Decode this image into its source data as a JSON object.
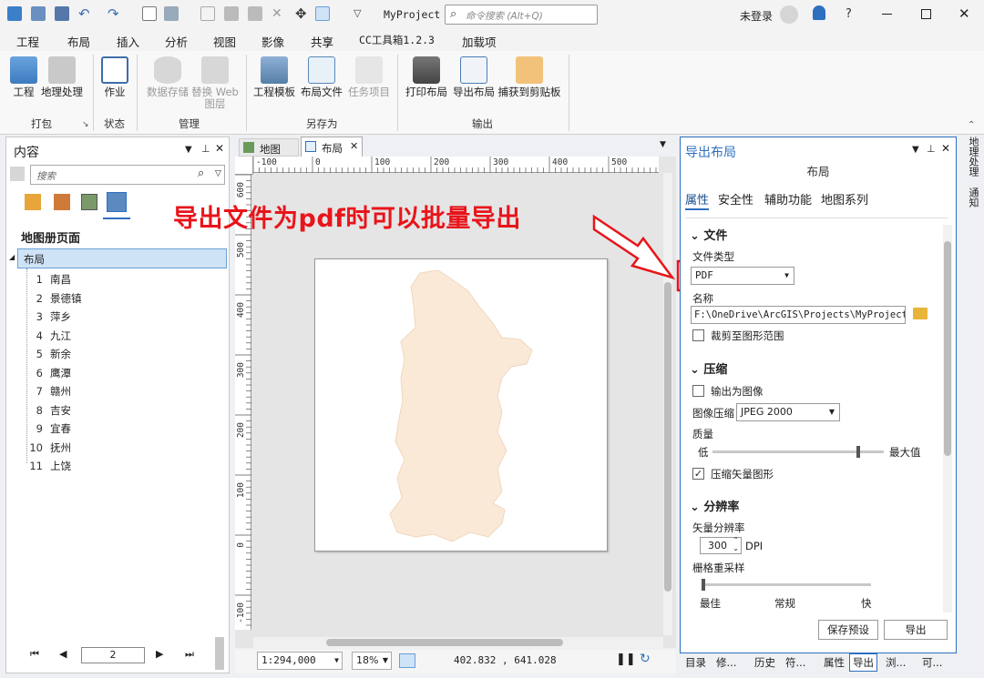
{
  "titlebar": {
    "project": "MyProject",
    "command_search_placeholder": "命令搜索 (Alt+Q)",
    "login_status": "未登录",
    "help_glyph": "?"
  },
  "ribbon_tabs": [
    "工程",
    "布局",
    "插入",
    "分析",
    "视图",
    "影像",
    "共享",
    "CC工具箱1.2.3",
    "加载项"
  ],
  "active_tab": "共享",
  "ribbon": {
    "project": "工程",
    "geoprocessing": "地理处理",
    "job": "作业",
    "data_store": "数据存储",
    "replace_web_layer_1": "替换",
    "replace_web_layer_2": "Web",
    "replace_web_layer_3": "图层",
    "project_template": "工程模板",
    "layout_file": "布局文件",
    "task_item": "任务项目",
    "print_layout": "打印布局",
    "export_layout": "导出布局",
    "capture_clipboard": "捕获到剪贴板",
    "group_package": "打包",
    "group_status": "状态",
    "group_manage": "管理",
    "group_save_as": "另存为",
    "group_output": "输出"
  },
  "contents": {
    "title": "内容",
    "search_placeholder": "搜索",
    "section_title": "地图册页面",
    "root": "布局",
    "pages": [
      {
        "num": "1",
        "name": "南昌"
      },
      {
        "num": "2",
        "name": "景德镇"
      },
      {
        "num": "3",
        "name": "萍乡"
      },
      {
        "num": "4",
        "name": "九江"
      },
      {
        "num": "5",
        "name": "新余"
      },
      {
        "num": "6",
        "name": "鹰潭"
      },
      {
        "num": "7",
        "name": "赣州"
      },
      {
        "num": "8",
        "name": "吉安"
      },
      {
        "num": "9",
        "name": "宜春"
      },
      {
        "num": "10",
        "name": "抚州"
      },
      {
        "num": "11",
        "name": "上饶"
      }
    ],
    "current_page": "2"
  },
  "view_tabs": {
    "map": "地图",
    "layout": "布局"
  },
  "rulers": {
    "h": [
      "-100",
      "0",
      "100",
      "200",
      "300",
      "400",
      "500"
    ],
    "v": [
      "600",
      "500",
      "400",
      "300",
      "200",
      "100",
      "0",
      "-100"
    ]
  },
  "statusbar": {
    "scale": "1:294,000",
    "zoom": "18%",
    "coordinates": "402.832 , 641.028"
  },
  "annotation": {
    "text": "导出文件为pdf时可以批量导出",
    "color": "#e8151b"
  },
  "export_panel": {
    "title": "导出布局",
    "subtitle": "布局",
    "tabs": [
      "属性",
      "安全性",
      "辅助功能",
      "地图系列"
    ],
    "section_file": "文件",
    "file_type_label": "文件类型",
    "file_type_value": "PDF",
    "name_label": "名称",
    "name_value": "F:\\OneDrive\\ArcGIS\\Projects\\MyProject\\",
    "clip_to_graphics": "裁剪至图形范围",
    "section_compression": "压缩",
    "output_as_image": "输出为图像",
    "image_compression_label": "图像压缩",
    "image_compression_value": "JPEG 2000",
    "quality_label": "质量",
    "quality_low": "低",
    "quality_high": "最大值",
    "quality_level": 0.86,
    "compress_vector": "压缩矢量图形",
    "section_resolution": "分辨率",
    "vector_resolution_label": "矢量分辨率",
    "vector_resolution_value": "300",
    "dpi": "DPI",
    "raster_resample_label": "栅格重采样",
    "resample_best": "最佳",
    "resample_normal": "常规",
    "resample_fast": "快",
    "save_preset": "保存预设",
    "export": "导出"
  },
  "right_edge_tabs": [
    "地理处理",
    "通知"
  ],
  "bottom_tabs": [
    "目录",
    "修...",
    "历史",
    "符...",
    "属性",
    "导出",
    "浏...",
    "可..."
  ],
  "colors": {
    "accent": "#2e6fbf",
    "map_fill": "#fbe9d8",
    "annotation": "#e8151b"
  }
}
